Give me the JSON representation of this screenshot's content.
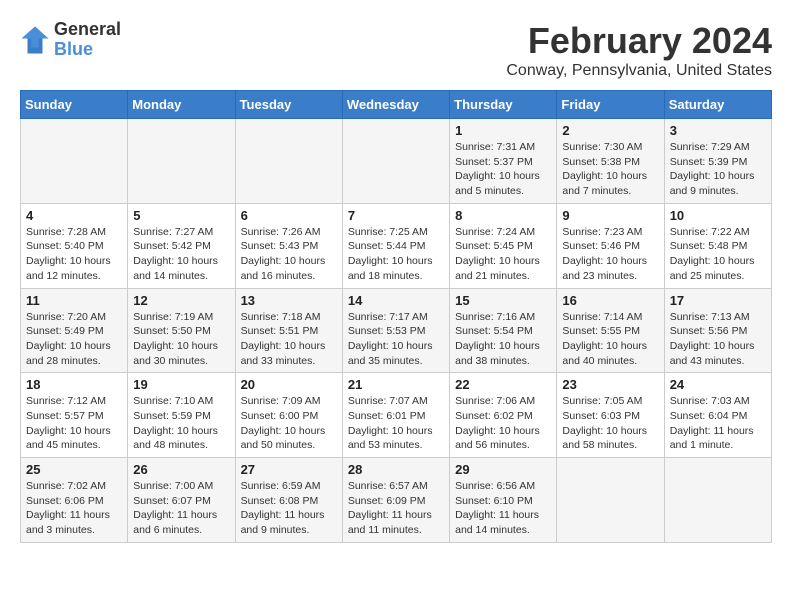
{
  "header": {
    "logo_line1": "General",
    "logo_line2": "Blue",
    "month_title": "February 2024",
    "location": "Conway, Pennsylvania, United States"
  },
  "days_of_week": [
    "Sunday",
    "Monday",
    "Tuesday",
    "Wednesday",
    "Thursday",
    "Friday",
    "Saturday"
  ],
  "weeks": [
    [
      {
        "day": "",
        "info": ""
      },
      {
        "day": "",
        "info": ""
      },
      {
        "day": "",
        "info": ""
      },
      {
        "day": "",
        "info": ""
      },
      {
        "day": "1",
        "info": "Sunrise: 7:31 AM\nSunset: 5:37 PM\nDaylight: 10 hours\nand 5 minutes."
      },
      {
        "day": "2",
        "info": "Sunrise: 7:30 AM\nSunset: 5:38 PM\nDaylight: 10 hours\nand 7 minutes."
      },
      {
        "day": "3",
        "info": "Sunrise: 7:29 AM\nSunset: 5:39 PM\nDaylight: 10 hours\nand 9 minutes."
      }
    ],
    [
      {
        "day": "4",
        "info": "Sunrise: 7:28 AM\nSunset: 5:40 PM\nDaylight: 10 hours\nand 12 minutes."
      },
      {
        "day": "5",
        "info": "Sunrise: 7:27 AM\nSunset: 5:42 PM\nDaylight: 10 hours\nand 14 minutes."
      },
      {
        "day": "6",
        "info": "Sunrise: 7:26 AM\nSunset: 5:43 PM\nDaylight: 10 hours\nand 16 minutes."
      },
      {
        "day": "7",
        "info": "Sunrise: 7:25 AM\nSunset: 5:44 PM\nDaylight: 10 hours\nand 18 minutes."
      },
      {
        "day": "8",
        "info": "Sunrise: 7:24 AM\nSunset: 5:45 PM\nDaylight: 10 hours\nand 21 minutes."
      },
      {
        "day": "9",
        "info": "Sunrise: 7:23 AM\nSunset: 5:46 PM\nDaylight: 10 hours\nand 23 minutes."
      },
      {
        "day": "10",
        "info": "Sunrise: 7:22 AM\nSunset: 5:48 PM\nDaylight: 10 hours\nand 25 minutes."
      }
    ],
    [
      {
        "day": "11",
        "info": "Sunrise: 7:20 AM\nSunset: 5:49 PM\nDaylight: 10 hours\nand 28 minutes."
      },
      {
        "day": "12",
        "info": "Sunrise: 7:19 AM\nSunset: 5:50 PM\nDaylight: 10 hours\nand 30 minutes."
      },
      {
        "day": "13",
        "info": "Sunrise: 7:18 AM\nSunset: 5:51 PM\nDaylight: 10 hours\nand 33 minutes."
      },
      {
        "day": "14",
        "info": "Sunrise: 7:17 AM\nSunset: 5:53 PM\nDaylight: 10 hours\nand 35 minutes."
      },
      {
        "day": "15",
        "info": "Sunrise: 7:16 AM\nSunset: 5:54 PM\nDaylight: 10 hours\nand 38 minutes."
      },
      {
        "day": "16",
        "info": "Sunrise: 7:14 AM\nSunset: 5:55 PM\nDaylight: 10 hours\nand 40 minutes."
      },
      {
        "day": "17",
        "info": "Sunrise: 7:13 AM\nSunset: 5:56 PM\nDaylight: 10 hours\nand 43 minutes."
      }
    ],
    [
      {
        "day": "18",
        "info": "Sunrise: 7:12 AM\nSunset: 5:57 PM\nDaylight: 10 hours\nand 45 minutes."
      },
      {
        "day": "19",
        "info": "Sunrise: 7:10 AM\nSunset: 5:59 PM\nDaylight: 10 hours\nand 48 minutes."
      },
      {
        "day": "20",
        "info": "Sunrise: 7:09 AM\nSunset: 6:00 PM\nDaylight: 10 hours\nand 50 minutes."
      },
      {
        "day": "21",
        "info": "Sunrise: 7:07 AM\nSunset: 6:01 PM\nDaylight: 10 hours\nand 53 minutes."
      },
      {
        "day": "22",
        "info": "Sunrise: 7:06 AM\nSunset: 6:02 PM\nDaylight: 10 hours\nand 56 minutes."
      },
      {
        "day": "23",
        "info": "Sunrise: 7:05 AM\nSunset: 6:03 PM\nDaylight: 10 hours\nand 58 minutes."
      },
      {
        "day": "24",
        "info": "Sunrise: 7:03 AM\nSunset: 6:04 PM\nDaylight: 11 hours\nand 1 minute."
      }
    ],
    [
      {
        "day": "25",
        "info": "Sunrise: 7:02 AM\nSunset: 6:06 PM\nDaylight: 11 hours\nand 3 minutes."
      },
      {
        "day": "26",
        "info": "Sunrise: 7:00 AM\nSunset: 6:07 PM\nDaylight: 11 hours\nand 6 minutes."
      },
      {
        "day": "27",
        "info": "Sunrise: 6:59 AM\nSunset: 6:08 PM\nDaylight: 11 hours\nand 9 minutes."
      },
      {
        "day": "28",
        "info": "Sunrise: 6:57 AM\nSunset: 6:09 PM\nDaylight: 11 hours\nand 11 minutes."
      },
      {
        "day": "29",
        "info": "Sunrise: 6:56 AM\nSunset: 6:10 PM\nDaylight: 11 hours\nand 14 minutes."
      },
      {
        "day": "",
        "info": ""
      },
      {
        "day": "",
        "info": ""
      }
    ]
  ]
}
